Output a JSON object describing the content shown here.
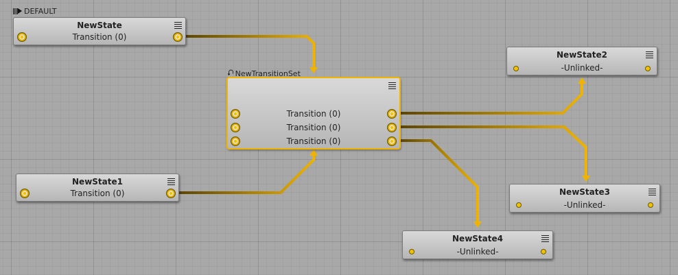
{
  "graph": {
    "default_label": "DEFAULT",
    "transition_set_label": "NewTransitionSet",
    "default_icon": "entry-arrow-icon",
    "transition_set_icon": "transition-set-icon",
    "wire_color": "#f0b400",
    "selection_color": "#f0b400"
  },
  "nodes": {
    "new_state": {
      "title": "NewState",
      "row": "Transition (0)"
    },
    "new_state1": {
      "title": "NewState1",
      "row": "Transition (0)"
    },
    "transition_set": {
      "rows": [
        "Transition (0)",
        "Transition (0)",
        "Transition (0)"
      ]
    },
    "new_state2": {
      "title": "NewState2",
      "row": "-Unlinked-"
    },
    "new_state3": {
      "title": "NewState3",
      "row": "-Unlinked-"
    },
    "new_state4": {
      "title": "NewState4",
      "row": "-Unlinked-"
    }
  }
}
